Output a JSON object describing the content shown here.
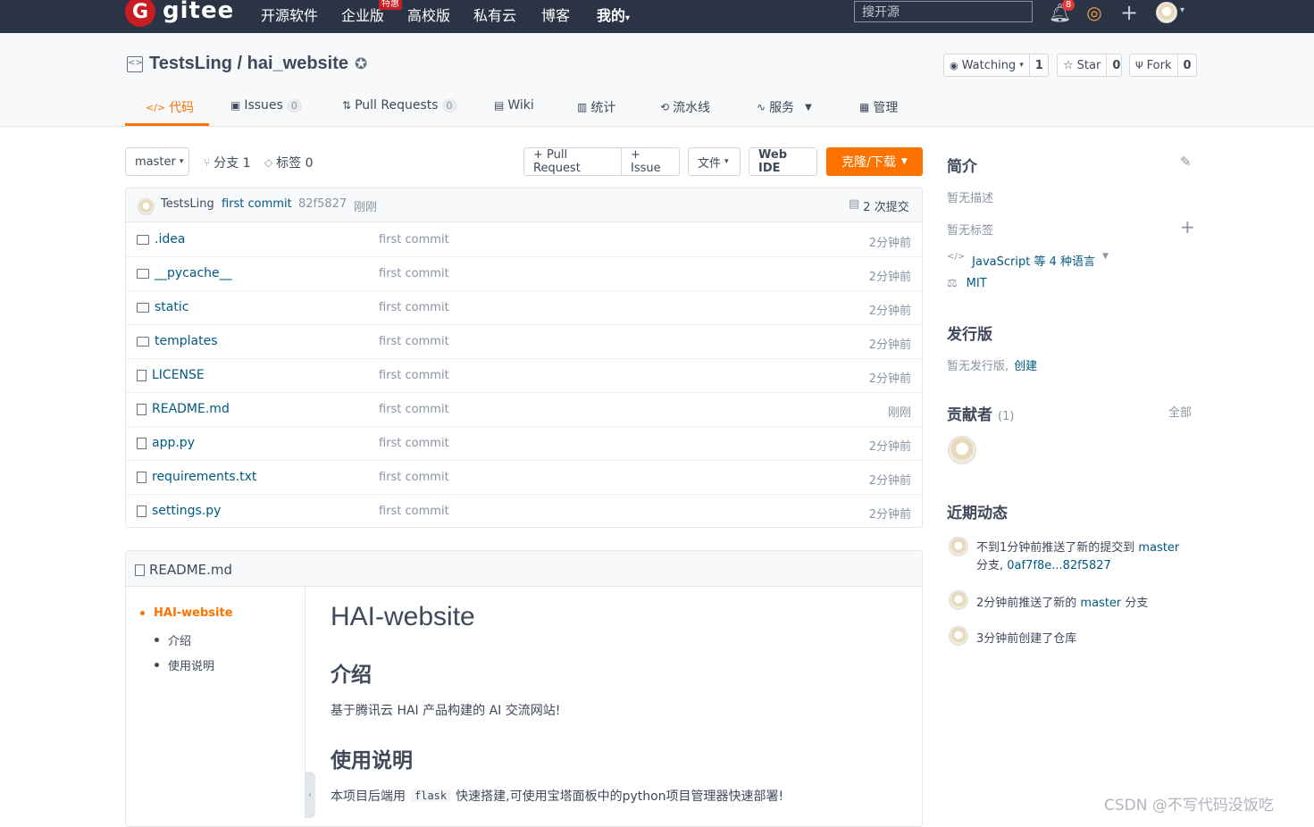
{
  "topnav": {
    "logo_text": "gitee",
    "links": [
      "开源软件",
      "企业版",
      "高校版",
      "私有云",
      "博客",
      "我的"
    ],
    "enterprise_badge": "特惠",
    "search_placeholder": "搜开源",
    "notification_count": "8"
  },
  "repo": {
    "title": "TestsLing / hai_website",
    "watch_label": "Watching",
    "watch_count": "1",
    "star_label": "Star",
    "star_count": "0",
    "fork_label": "Fork",
    "fork_count": "0"
  },
  "tabs": [
    {
      "label": "代码",
      "count": ""
    },
    {
      "label": "Issues",
      "count": "0"
    },
    {
      "label": "Pull Requests",
      "count": "0"
    },
    {
      "label": "Wiki",
      "count": ""
    },
    {
      "label": "统计",
      "count": ""
    },
    {
      "label": "流水线",
      "count": ""
    },
    {
      "label": "服务",
      "count": ""
    },
    {
      "label": "管理",
      "count": ""
    }
  ],
  "toolbar": {
    "branch": "master",
    "branches": "分支 1",
    "tags": "标签 0",
    "pull_request": "+ Pull Request",
    "issue": "+ Issue",
    "file": "文件",
    "web_ide": "Web IDE",
    "clone": "克隆/下载"
  },
  "last_commit": {
    "author": "TestsLing",
    "message": "first commit",
    "hash": "82f5827",
    "time": "刚刚",
    "commits": "2 次提交"
  },
  "files": [
    {
      "name": ".idea",
      "type": "folder",
      "message": "first commit",
      "time": "2分钟前"
    },
    {
      "name": "__pycache__",
      "type": "folder",
      "message": "first commit",
      "time": "2分钟前"
    },
    {
      "name": "static",
      "type": "folder",
      "message": "first commit",
      "time": "2分钟前"
    },
    {
      "name": "templates",
      "type": "folder",
      "message": "first commit",
      "time": "2分钟前"
    },
    {
      "name": "LICENSE",
      "type": "file",
      "message": "first commit",
      "time": "2分钟前"
    },
    {
      "name": "README.md",
      "type": "file",
      "message": "first commit",
      "time": "刚刚"
    },
    {
      "name": "app.py",
      "type": "file",
      "message": "first commit",
      "time": "2分钟前"
    },
    {
      "name": "requirements.txt",
      "type": "file",
      "message": "first commit",
      "time": "2分钟前"
    },
    {
      "name": "settings.py",
      "type": "file",
      "message": "first commit",
      "time": "2分钟前"
    }
  ],
  "readme": {
    "filename": "README.md",
    "toc": [
      "HAI-website",
      "介绍",
      "使用说明"
    ],
    "h1": "HAI-website",
    "h2_intro": "介绍",
    "intro_text": "基于腾讯云 HAI 产品构建的 AI 交流网站!",
    "h2_usage": "使用说明",
    "usage_pre": "本项目后端用",
    "usage_code": "flask",
    "usage_post": "快速搭建,可使用宝塔面板中的python项目管理器快速部署!"
  },
  "sidebar": {
    "intro_title": "简介",
    "no_desc": "暂无描述",
    "no_tags": "暂无标签",
    "languages": "JavaScript 等 4 种语言",
    "license": "MIT",
    "release_title": "发行版",
    "no_release": "暂无发行版,",
    "create_link": "创建",
    "contrib_title": "贡献者",
    "contrib_count": "(1)",
    "contrib_all": "全部",
    "activity_title": "近期动态",
    "activities": [
      {
        "pre": "不到1分钟前推送了新的提交到",
        "branch": "master",
        "post": "分支,",
        "line2": "0af7f8e...82f5827"
      },
      {
        "pre": "2分钟前推送了新的",
        "branch": "master",
        "post": "分支",
        "line2": ""
      },
      {
        "pre": "3分钟前创建了仓库",
        "branch": "",
        "post": "",
        "line2": ""
      }
    ]
  },
  "watermark": "CSDN @不写代码没饭吃"
}
